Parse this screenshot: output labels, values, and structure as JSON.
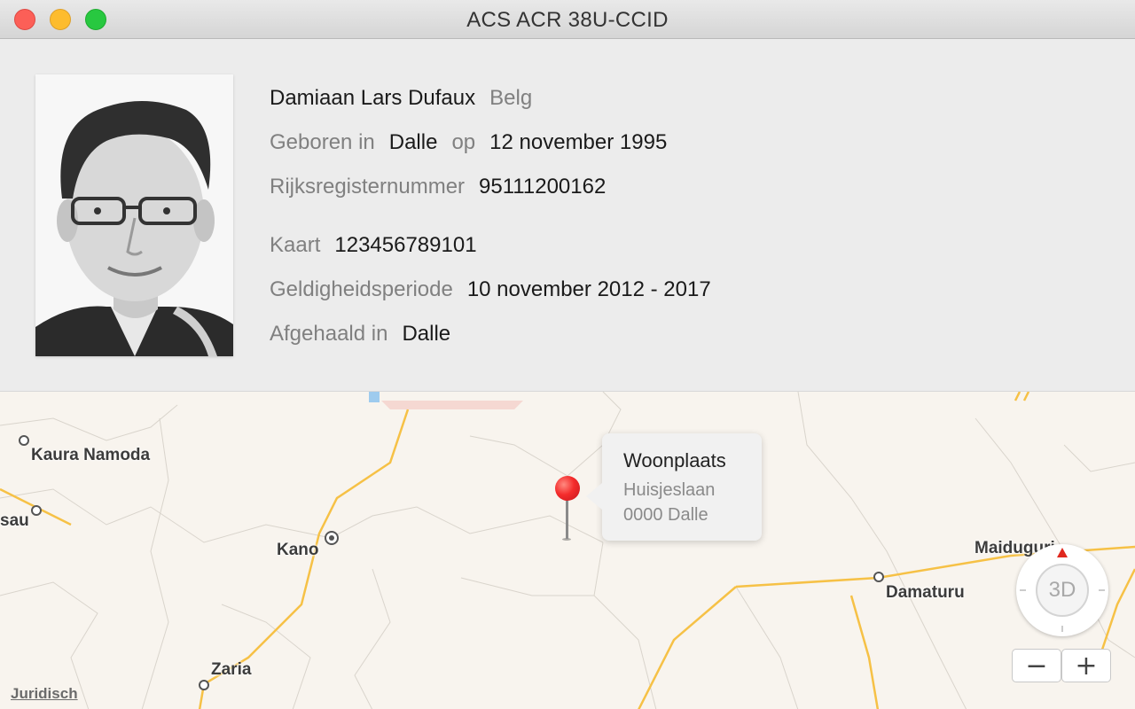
{
  "window": {
    "title": "ACS ACR 38U-CCID"
  },
  "person": {
    "name": "Damiaan Lars Dufaux",
    "nationality": "Belg",
    "born_label": "Geboren in",
    "born_place": "Dalle",
    "on_label": "op",
    "born_date": "12 november 1995",
    "national_number_label": "Rijksregisternummer",
    "national_number": "95111200162"
  },
  "card": {
    "card_label": "Kaart",
    "card_number": "123456789101",
    "validity_label": "Geldigheidsperiode",
    "validity": "10 november 2012 - 2017",
    "issued_label": "Afgehaald in",
    "issued_place": "Dalle"
  },
  "map": {
    "cities": {
      "kaura_namoda": "Kaura Namoda",
      "sau": "sau",
      "kano": "Kano",
      "zaria": "Zaria",
      "maiduguri": "Maiduguri",
      "damaturu": "Damaturu"
    },
    "callout": {
      "title": "Woonplaats",
      "street": "Huisjeslaan",
      "city": "0000 Dalle"
    },
    "legal_link": "Juridisch",
    "compass_label": "3D",
    "zoom_out": "−",
    "zoom_in": "+"
  },
  "colors": {
    "pin": "#f42c2c",
    "road": "#f6c146",
    "map_background": "#f8f4ee"
  }
}
